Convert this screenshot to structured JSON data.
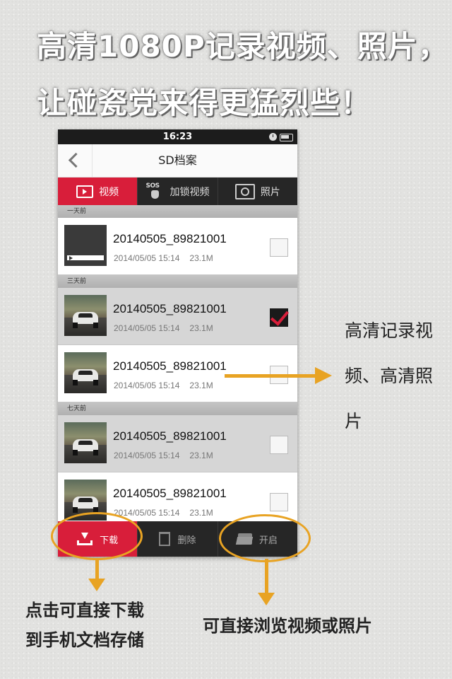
{
  "headline": {
    "line1": "高清1080P记录视频、照片，",
    "line2": "让碰瓷党来得更猛烈些！"
  },
  "status_bar": {
    "time": "16:23"
  },
  "nav": {
    "title": "SD档案"
  },
  "tabs": [
    {
      "label": "视频",
      "active": true,
      "icon": "video-icon"
    },
    {
      "label": "加锁视频",
      "active": false,
      "icon": "sos-lock-icon"
    },
    {
      "label": "照片",
      "active": false,
      "icon": "camera-icon"
    }
  ],
  "sections": [
    {
      "header": "一天前",
      "files": [
        {
          "name": "20140505_89821001",
          "datetime": "2014/05/05 15:14",
          "size": "23.1M",
          "checked": false,
          "thumb": "video-placeholder"
        }
      ]
    },
    {
      "header": "三天前",
      "files": [
        {
          "name": "20140505_89821001",
          "datetime": "2014/05/05 15:14",
          "size": "23.1M",
          "checked": true,
          "thumb": "car"
        },
        {
          "name": "20140505_89821001",
          "datetime": "2014/05/05 15:14",
          "size": "23.1M",
          "checked": false,
          "thumb": "car"
        }
      ]
    },
    {
      "header": "七天前",
      "files": [
        {
          "name": "20140505_89821001",
          "datetime": "2014/05/05 15:14",
          "size": "23.1M",
          "checked": false,
          "thumb": "car"
        },
        {
          "name": "20140505_89821001",
          "datetime": "2014/05/05 15:14",
          "size": "23.1M",
          "checked": false,
          "thumb": "car"
        }
      ]
    }
  ],
  "bottom_bar": {
    "download": "下载",
    "delete": "删除",
    "open": "开启"
  },
  "annotations": {
    "side_caption": "高清记录视频、高清照片",
    "download_caption_line1": "点击可直接下载",
    "download_caption_line2": "到手机文档存储",
    "open_caption": "可直接浏览视频或照片"
  },
  "colors": {
    "accent_red": "#d81e3a",
    "annotation_orange": "#e8a323",
    "dark_bar": "#262626"
  }
}
